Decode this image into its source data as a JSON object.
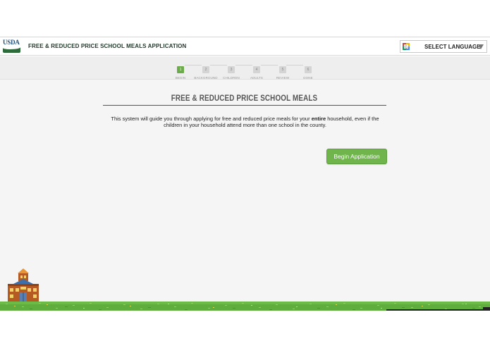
{
  "header": {
    "logo_text": "USDA",
    "app_title": "FREE & REDUCED PRICE SCHOOL MEALS APPLICATION",
    "language": {
      "label": "SELECT LANGUAGE"
    }
  },
  "steps": [
    {
      "num": "1",
      "label": "BEGIN",
      "active": true
    },
    {
      "num": "2",
      "label": "BACKGROUND",
      "active": false
    },
    {
      "num": "3",
      "label": "CHILDREN",
      "active": false
    },
    {
      "num": "4",
      "label": "ADULTS",
      "active": false
    },
    {
      "num": "5",
      "label": "REVIEW",
      "active": false
    },
    {
      "num": "6",
      "label": "DONE",
      "active": false
    }
  ],
  "main": {
    "title": "FREE & REDUCED PRICE SCHOOL MEALS",
    "desc_before": "This system will guide you through applying for free and reduced price meals for your ",
    "desc_bold": "entire",
    "desc_after": " household, even if the children in your household attend more than one school in the county.",
    "begin_label": "Begin Application"
  },
  "colors": {
    "accent_green": "#6fb54b",
    "active_step": "#6bab4a",
    "grass": "#5fae3d",
    "usda_blue": "#1f4e7a",
    "usda_green": "#2e6b3a"
  }
}
